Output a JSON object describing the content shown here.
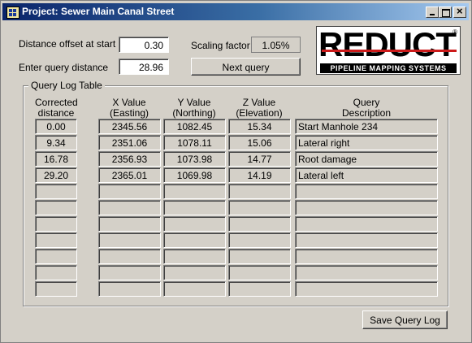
{
  "window": {
    "title": "Project: Sewer Main Canal Street",
    "minimize_icon": "minimize-icon",
    "maximize_icon": "maximize-icon",
    "close_icon": "close-icon"
  },
  "form": {
    "distance_offset_label": "Distance offset at start",
    "distance_offset_value": "0.30",
    "query_distance_label": "Enter query distance",
    "query_distance_value": "28.96",
    "scaling_factor_label": "Scaling factor",
    "scaling_factor_value": "1.05%",
    "next_query_label": "Next query"
  },
  "logo": {
    "word": "REDUCT",
    "registered": "®",
    "tagline": "PIPELINE MAPPING SYSTEMS",
    "accent_color": "#cc1a1a"
  },
  "table": {
    "group_label": "Query Log Table",
    "headers": {
      "distance": [
        "Corrected",
        "distance"
      ],
      "x": [
        "X Value",
        "(Easting)"
      ],
      "y": [
        "Y Value",
        "(Northing)"
      ],
      "z": [
        "Z Value",
        "(Elevation)"
      ],
      "desc": [
        "Query",
        "Description"
      ]
    },
    "rows": [
      {
        "distance": "0.00",
        "x": "2345.56",
        "y": "1082.45",
        "z": "15.34",
        "desc": "Start Manhole 234"
      },
      {
        "distance": "9.34",
        "x": "2351.06",
        "y": "1078.11",
        "z": "15.06",
        "desc": "Lateral right"
      },
      {
        "distance": "16.78",
        "x": "2356.93",
        "y": "1073.98",
        "z": "14.77",
        "desc": "Root damage"
      },
      {
        "distance": "29.20",
        "x": "2365.01",
        "y": "1069.98",
        "z": "14.19",
        "desc": "Lateral left"
      },
      {
        "distance": "",
        "x": "",
        "y": "",
        "z": "",
        "desc": ""
      },
      {
        "distance": "",
        "x": "",
        "y": "",
        "z": "",
        "desc": ""
      },
      {
        "distance": "",
        "x": "",
        "y": "",
        "z": "",
        "desc": ""
      },
      {
        "distance": "",
        "x": "",
        "y": "",
        "z": "",
        "desc": ""
      },
      {
        "distance": "",
        "x": "",
        "y": "",
        "z": "",
        "desc": ""
      },
      {
        "distance": "",
        "x": "",
        "y": "",
        "z": "",
        "desc": ""
      },
      {
        "distance": "",
        "x": "",
        "y": "",
        "z": "",
        "desc": ""
      }
    ]
  },
  "footer": {
    "save_label": "Save Query Log"
  }
}
